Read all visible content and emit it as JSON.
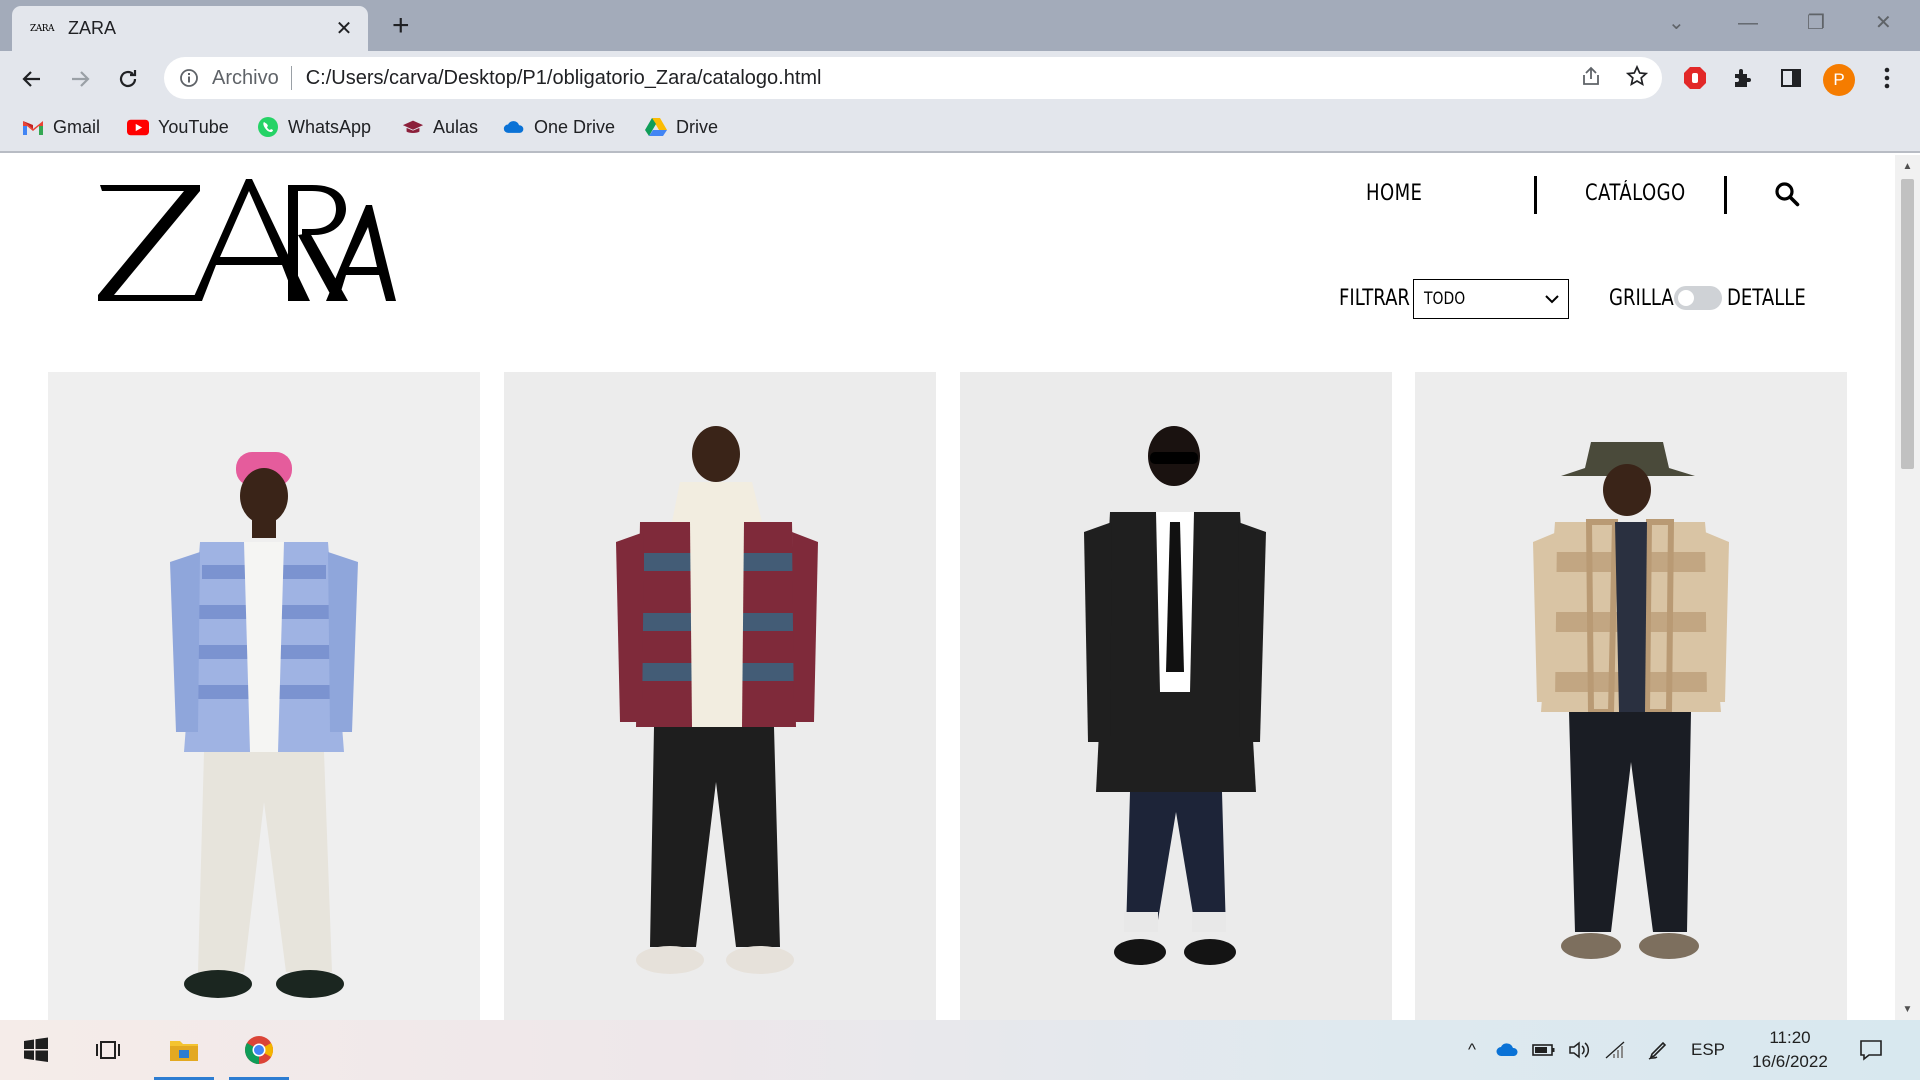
{
  "browser": {
    "tab": {
      "favicon_text": "ZARA",
      "title": "ZARA"
    },
    "omnibox": {
      "chip": "Archivo",
      "url": "C:/Users/carva/Desktop/P1/obligatorio_Zara/catalogo.html"
    },
    "profile_initial": "P",
    "bookmarks": [
      {
        "label": "Gmail",
        "icon": "gmail-icon"
      },
      {
        "label": "YouTube",
        "icon": "youtube-icon"
      },
      {
        "label": "WhatsApp",
        "icon": "whatsapp-icon"
      },
      {
        "label": "Aulas",
        "icon": "graduation-cap-icon"
      },
      {
        "label": "One Drive",
        "icon": "onedrive-icon"
      },
      {
        "label": "Drive",
        "icon": "google-drive-icon"
      }
    ]
  },
  "site": {
    "logo": "ZARA",
    "nav": {
      "home": "HOME",
      "catalog": "CATÁLOGO"
    },
    "filter": {
      "label": "FILTRAR",
      "selected": "TODO"
    },
    "view_toggle": {
      "left_label": "GRILLA",
      "right_label": "DETALLE",
      "on": false
    },
    "products": [
      {
        "name": "model-pink-beanie-striped-cardigan",
        "colors": {
          "bg": "#efefef",
          "top": "#8fa6db",
          "accent": "#e55c9c",
          "bottom": "#e7e4dc",
          "shoes": "#1b2620"
        }
      },
      {
        "name": "model-patterned-overshirt-hoodie",
        "colors": {
          "bg": "#ececec",
          "top": "#7f2a3a",
          "accent": "#f2ede0",
          "bottom": "#1e1e1e",
          "shoes": "#e6e1da"
        }
      },
      {
        "name": "model-black-coat-tie",
        "colors": {
          "bg": "#ebebeb",
          "top": "#1f1f1f",
          "accent": "#ffffff",
          "bottom": "#1d2438",
          "shoes": "#141414"
        }
      },
      {
        "name": "model-check-fleece-bucket-hat",
        "colors": {
          "bg": "#ededed",
          "top": "#d9c4a4",
          "accent": "#4a4a3a",
          "bottom": "#1a1d24",
          "shoes": "#7d6f5e"
        }
      }
    ]
  },
  "taskbar": {
    "language": "ESP",
    "time": "11:20",
    "date": "16/6/2022"
  },
  "colors": {
    "browser_frame": "#a3abba",
    "toolbar": "#e3e6ec",
    "profile": "#f57c00",
    "taskbar_accent": "#2d7dd2"
  }
}
